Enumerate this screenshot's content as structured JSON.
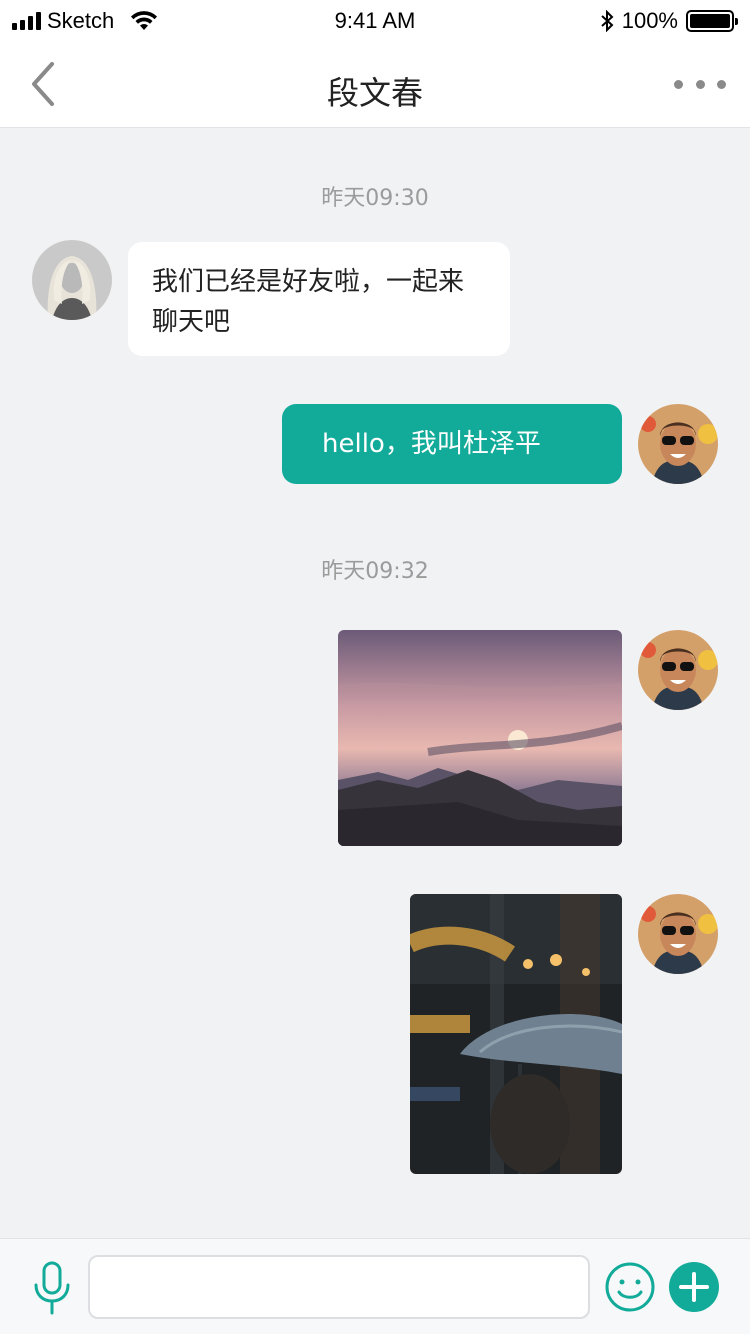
{
  "status_bar": {
    "carrier": "Sketch",
    "time": "9:41 AM",
    "battery": "100%"
  },
  "nav": {
    "title": "段文春",
    "icons": [
      "back-chevron-icon",
      "more-dots-icon"
    ]
  },
  "messages": [
    {
      "type": "timestamp",
      "text": "昨天09:30"
    },
    {
      "type": "text",
      "side": "left",
      "sender_avatar": "avatar-blonde-woman",
      "text_line1": "我们已经是好友啦，一起来",
      "text_line2": "聊天吧"
    },
    {
      "type": "text",
      "side": "right",
      "sender_avatar": "avatar-man-sunglasses",
      "text": "hello，我叫杜泽平"
    },
    {
      "type": "timestamp",
      "text": "昨天09:32"
    },
    {
      "type": "image",
      "side": "right",
      "sender_avatar": "avatar-man-sunglasses",
      "description_icon": "sunset-mountains-photo"
    },
    {
      "type": "image",
      "side": "right",
      "sender_avatar": "avatar-man-sunglasses",
      "description_icon": "umbrella-street-photo"
    }
  ],
  "input_bar": {
    "placeholder": "",
    "icons": [
      "microphone-icon",
      "emoji-smile-icon",
      "plus-circle-icon"
    ]
  },
  "colors": {
    "accent": "#12ab9a",
    "background": "#f1f2f4",
    "timestamp": "#9b9b9b",
    "bubble_left": "#ffffff"
  }
}
